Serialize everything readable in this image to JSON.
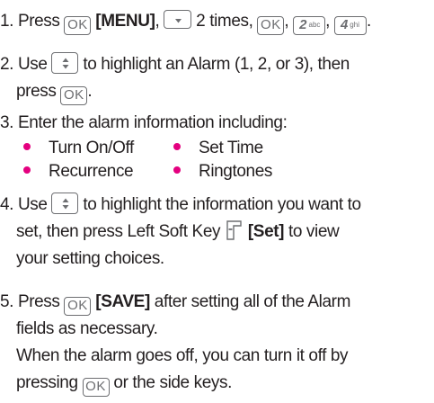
{
  "steps": [
    {
      "number": "1.",
      "parts": {
        "press": "Press",
        "menu": "[MENU]",
        "times": "2 times,"
      }
    },
    {
      "number": "2.",
      "line1_pre": "Use",
      "line1_post": "to highlight an Alarm (1, 2, or 3), then",
      "line2_pre": "press",
      "line2_post": "."
    },
    {
      "number": "3.",
      "text": "Enter the alarm information including:"
    },
    {
      "number": "4.",
      "line1_pre": "Use",
      "line1_post": "to highlight the information you want to",
      "line2_pre": "set, then press Left Soft Key",
      "line2_set": "[Set]",
      "line2_post": "to view",
      "line3": "your setting choices."
    },
    {
      "number": "5.",
      "line1_pre": "Press",
      "line1_save": "[SAVE]",
      "line1_post": "after setting all of the Alarm",
      "line2": "fields as necessary.",
      "line3": "When the alarm goes off, you can turn it off by",
      "line4_pre": "pressing",
      "line4_post": "or the side keys."
    }
  ],
  "alarm_fields": [
    "Turn On/Off",
    "Set Time",
    "Recurrence",
    "Ringtones"
  ],
  "keys": {
    "ok": "OK",
    "two_digit": "2",
    "two_letters": "abc",
    "four_digit": "4",
    "four_letters": "ghi"
  },
  "icons": {
    "ok_key": "ok-key-icon",
    "down_nav_key": "nav-down-key-icon",
    "up_down_nav_key": "nav-up-down-key-icon",
    "number_key": "number-key-icon",
    "left_soft_key": "left-soft-key-icon",
    "bullet": "bullet-dot-icon"
  },
  "colors": {
    "text": "#231f20",
    "key_outline": "#6d6e71",
    "bullet": "#e4007f"
  }
}
